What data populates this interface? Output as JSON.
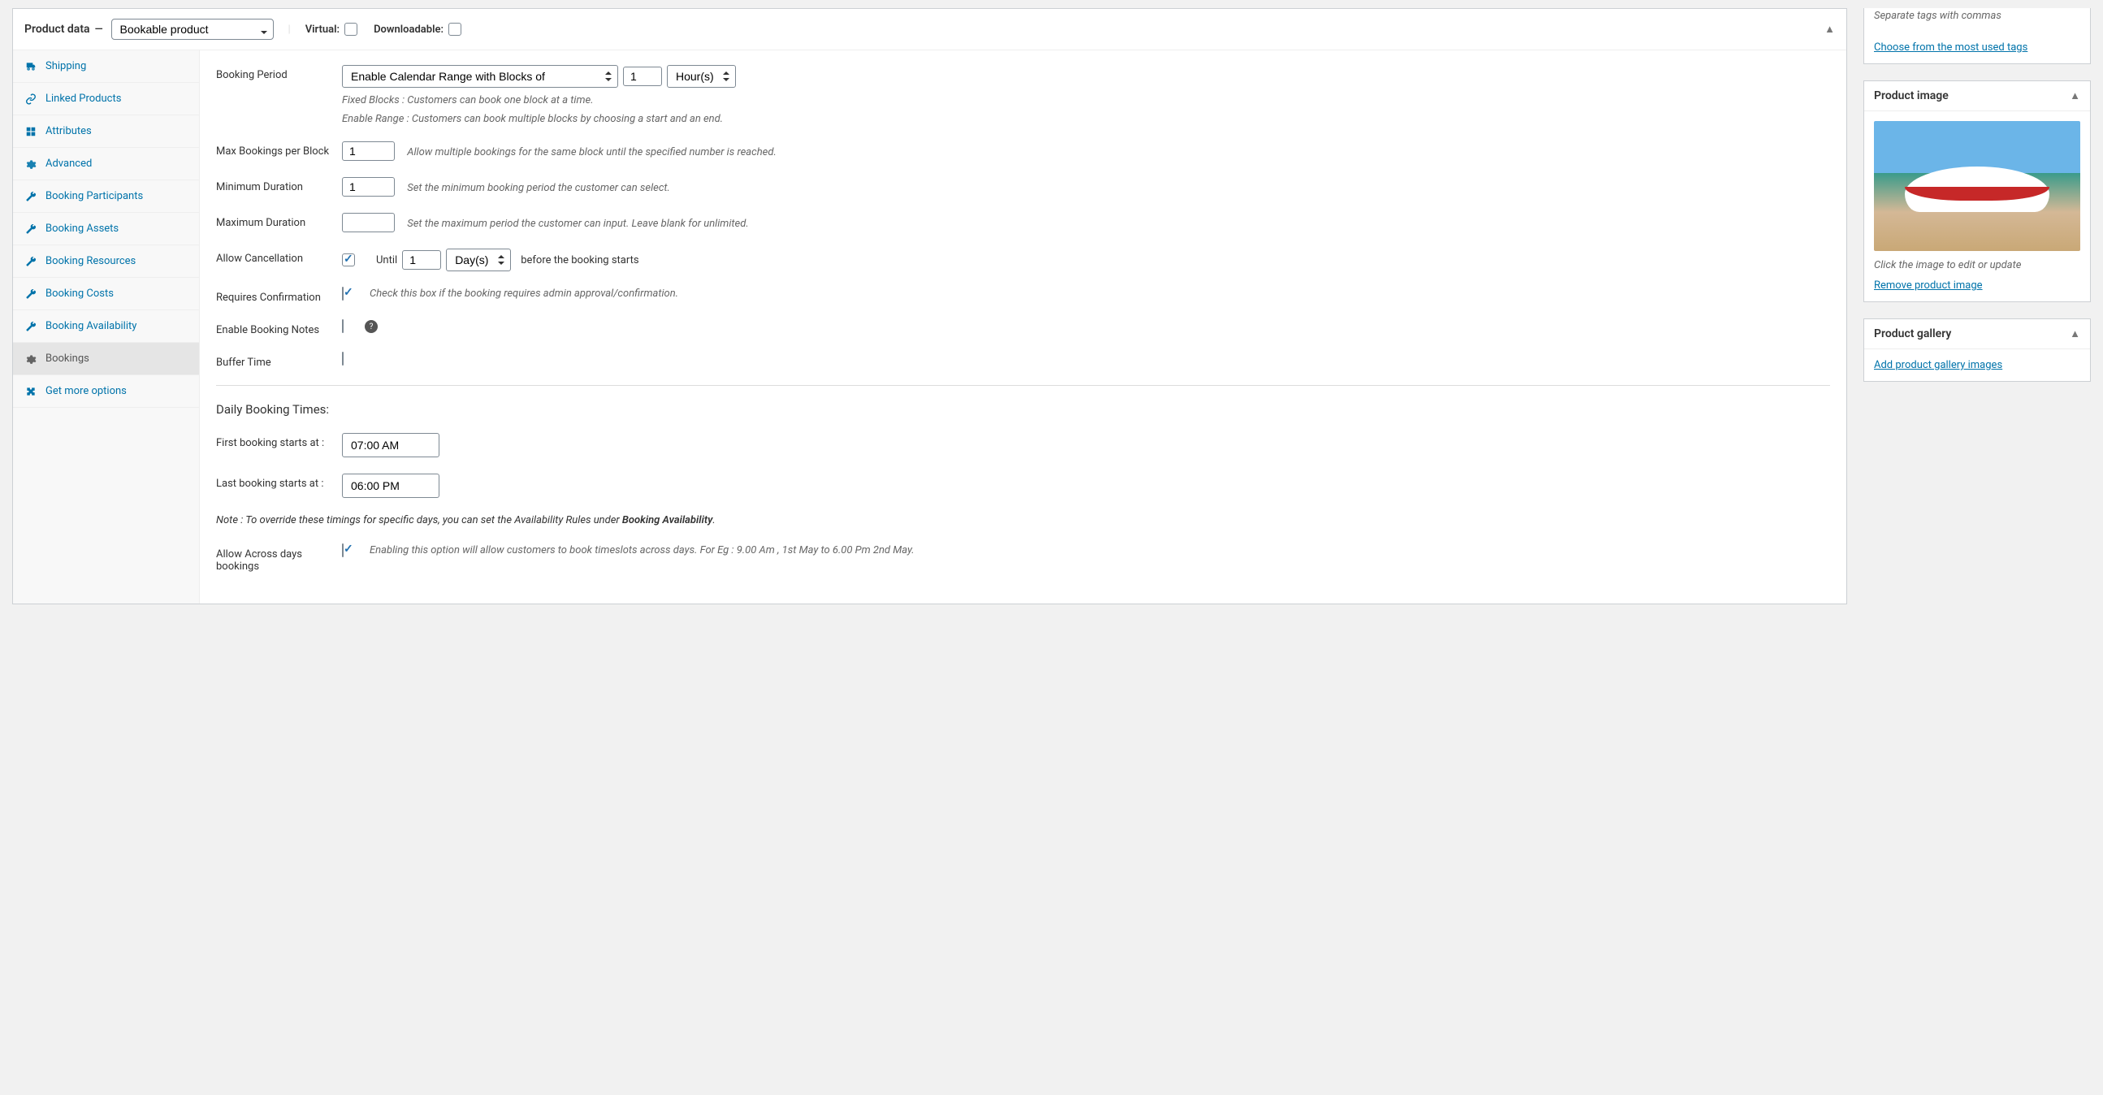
{
  "header": {
    "title": "Product data",
    "dash": "—",
    "productType": "Bookable product",
    "virtualLabel": "Virtual:",
    "downloadableLabel": "Downloadable:"
  },
  "tabs": [
    {
      "icon": "truck",
      "label": "Shipping"
    },
    {
      "icon": "link",
      "label": "Linked Products"
    },
    {
      "icon": "grid",
      "label": "Attributes"
    },
    {
      "icon": "gear",
      "label": "Advanced"
    },
    {
      "icon": "wrench",
      "label": "Booking Participants"
    },
    {
      "icon": "wrench",
      "label": "Booking Assets"
    },
    {
      "icon": "wrench",
      "label": "Booking Resources"
    },
    {
      "icon": "wrench",
      "label": "Booking Costs"
    },
    {
      "icon": "wrench",
      "label": "Booking Availability"
    },
    {
      "icon": "gear",
      "label": "Bookings",
      "active": true
    },
    {
      "icon": "puzzle",
      "label": "Get more options"
    }
  ],
  "form": {
    "bookingPeriod": {
      "label": "Booking Period",
      "select": "Enable Calendar Range with Blocks of",
      "qty": "1",
      "unit": "Hour(s)"
    },
    "help1": "Fixed Blocks : Customers can book one block at a time.",
    "help2": "Enable Range : Customers can book multiple blocks by choosing a start and an end.",
    "maxBookings": {
      "label": "Max Bookings per Block",
      "value": "1",
      "help": "Allow multiple bookings for the same block until the specified number is reached."
    },
    "minDuration": {
      "label": "Minimum Duration",
      "value": "1",
      "help": "Set the minimum booking period the customer can select."
    },
    "maxDuration": {
      "label": "Maximum Duration",
      "value": "",
      "help": "Set the maximum period the customer can input. Leave blank for unlimited."
    },
    "allowCancel": {
      "label": "Allow Cancellation",
      "until": "Until",
      "value": "1",
      "unit": "Day(s)",
      "after": "before the booking starts"
    },
    "requiresConfirm": {
      "label": "Requires Confirmation",
      "help": "Check this box if the booking requires admin approval/confirmation."
    },
    "enableNotes": {
      "label": "Enable Booking Notes"
    },
    "bufferTime": {
      "label": "Buffer Time"
    },
    "dailyTitle": "Daily Booking Times:",
    "firstBooking": {
      "label": "First booking starts at :",
      "value": "07:00 AM"
    },
    "lastBooking": {
      "label": "Last booking starts at :",
      "value": "06:00 PM"
    },
    "note": {
      "prefix": "Note : To override these timings for specific days, you can set the Availability Rules under ",
      "bold": "Booking Availability",
      "suffix": "."
    },
    "acrossDays": {
      "label": "Allow Across days bookings",
      "help": "Enabling this option will allow customers to book timeslots across days. For Eg : 9.00 Am , 1st May to 6.00 Pm 2nd May."
    }
  },
  "sidebar": {
    "tagsHint": "Separate tags with commas",
    "tagsLink": "Choose from the most used tags",
    "imageTitle": "Product image",
    "imageHint": "Click the image to edit or update",
    "removeImage": "Remove product image",
    "galleryTitle": "Product gallery",
    "addGallery": "Add product gallery images"
  }
}
